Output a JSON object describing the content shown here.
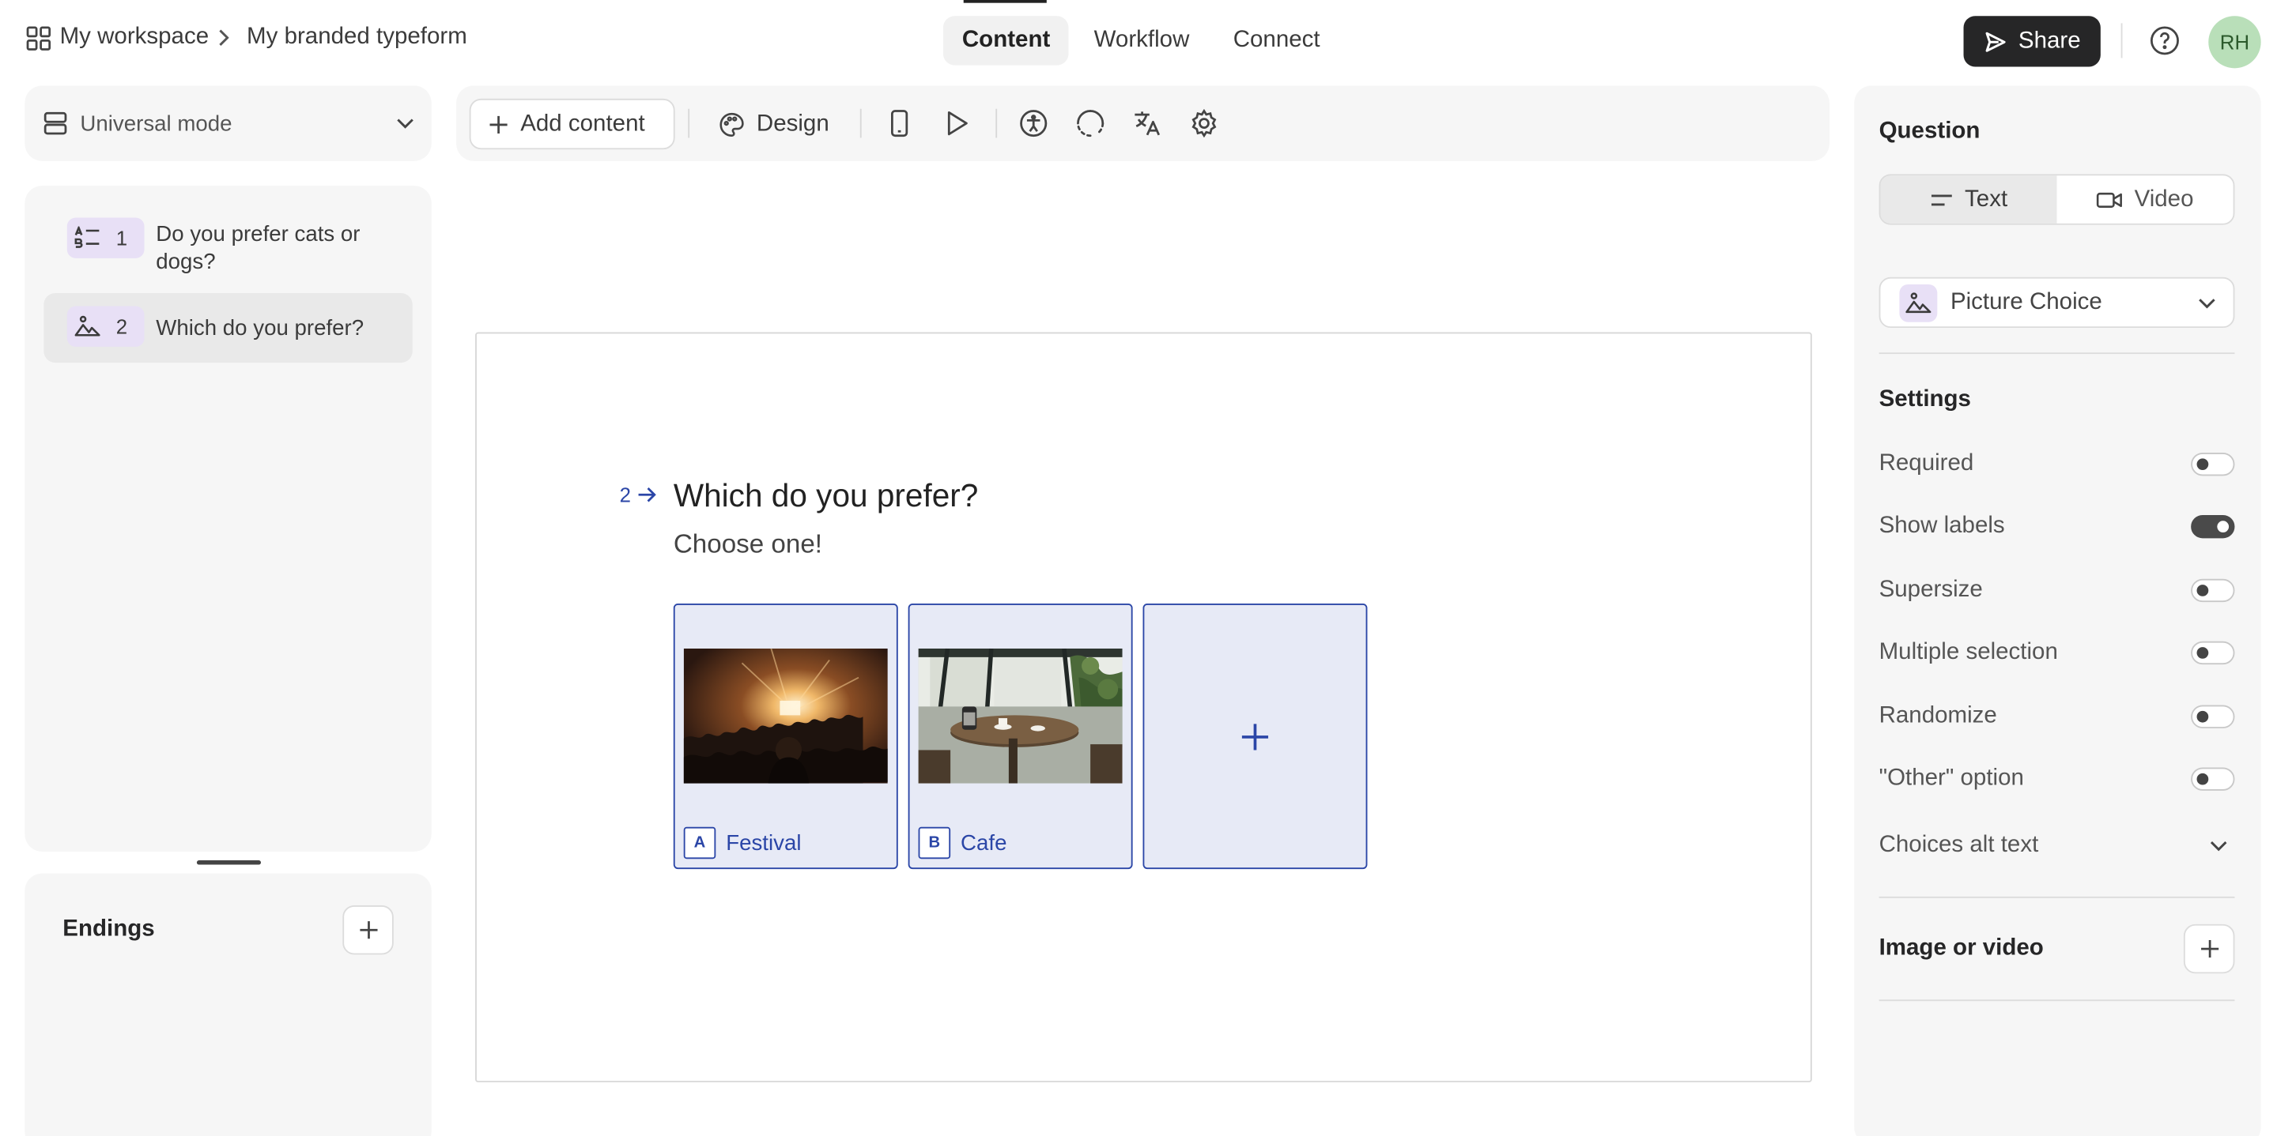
{
  "header": {
    "workspace": "My workspace",
    "form_name": "My branded typeform",
    "tabs": [
      {
        "label": "Content",
        "active": true
      },
      {
        "label": "Workflow",
        "active": false
      },
      {
        "label": "Connect",
        "active": false
      }
    ],
    "share_label": "Share",
    "avatar_initials": "RH"
  },
  "sidebar": {
    "mode_label": "Universal mode",
    "questions": [
      {
        "number": "1",
        "text": "Do you prefer cats or dogs?",
        "icon": "ranking-icon"
      },
      {
        "number": "2",
        "text": "Which do you prefer?",
        "icon": "picture-choice-icon"
      }
    ],
    "endings_label": "Endings"
  },
  "toolbar": {
    "add_content_label": "Add content",
    "design_label": "Design"
  },
  "canvas": {
    "question_number": "2",
    "question_title": "Which do you prefer?",
    "question_subtitle": "Choose one!",
    "choices": [
      {
        "letter": "A",
        "label": "Festival"
      },
      {
        "letter": "B",
        "label": "Cafe"
      }
    ]
  },
  "settings_panel": {
    "question_heading": "Question",
    "question_type_tabs": [
      "Text",
      "Video"
    ],
    "question_type_selected": "Text",
    "type_select_value": "Picture Choice",
    "settings_heading": "Settings",
    "settings": [
      {
        "label": "Required",
        "on": false
      },
      {
        "label": "Show labels",
        "on": true
      },
      {
        "label": "Supersize",
        "on": false
      },
      {
        "label": "Multiple selection",
        "on": false
      },
      {
        "label": "Randomize",
        "on": false
      },
      {
        "label": "\"Other\" option",
        "on": false
      }
    ],
    "choices_alt_text_label": "Choices alt text",
    "image_or_video_label": "Image or video"
  },
  "colors": {
    "accent": "#2b46a7",
    "dark": "#262627",
    "badge_bg": "#e8e0f6",
    "avatar_bg": "#b9dfb9"
  }
}
